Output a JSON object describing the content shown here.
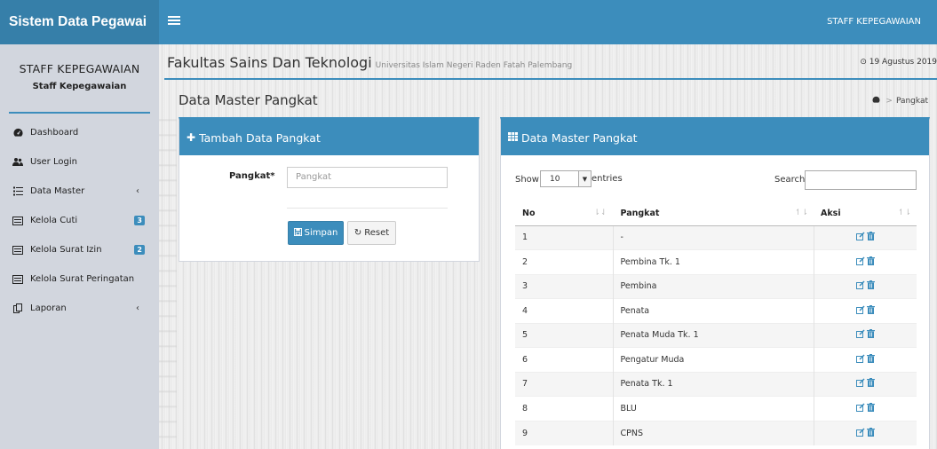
{
  "app": {
    "brand": "Sistem Data Pegawai",
    "nav_user": "STAFF KEPEGAWAIAN"
  },
  "sidebar": {
    "user_name": "STAFF KEPEGAWAIAN",
    "user_role": "Staff Kepegawaian",
    "items": [
      {
        "label": "Dashboard",
        "icon": "dashboard-icon"
      },
      {
        "label": "User Login",
        "icon": "users-icon"
      },
      {
        "label": "Data Master",
        "icon": "list-icon",
        "chevron": "‹"
      },
      {
        "label": "Kelola Cuti",
        "icon": "list-alt-icon",
        "badge": "3"
      },
      {
        "label": "Kelola Surat Izin",
        "icon": "list-alt-icon",
        "badge": "2"
      },
      {
        "label": "Kelola Surat Peringatan",
        "icon": "list-alt-icon"
      },
      {
        "label": "Laporan",
        "icon": "copy-icon",
        "chevron": "‹"
      }
    ]
  },
  "header": {
    "faculty": "Fakultas Sains Dan Teknologi",
    "university": "Universitas Islam Negeri Raden Fatah Palembang",
    "date": "⊙ 19 Agustus 2019"
  },
  "page": {
    "title": "Data Master Pangkat",
    "breadcrumb_current": "Pangkat"
  },
  "form": {
    "title": "Tambah Data Pangkat",
    "label": "Pangkat*",
    "placeholder": "Pangkat",
    "save_label": "Simpan",
    "reset_label": "Reset"
  },
  "table": {
    "title": "Data Master Pangkat",
    "show_label": "Show",
    "page_size": "10",
    "entries_label": "entries",
    "search_label": "Search:",
    "columns": [
      "No",
      "Pangkat",
      "Aksi"
    ],
    "rows": [
      {
        "no": "1",
        "pangkat": "-"
      },
      {
        "no": "2",
        "pangkat": "Pembina Tk. 1"
      },
      {
        "no": "3",
        "pangkat": "Pembina"
      },
      {
        "no": "4",
        "pangkat": "Penata"
      },
      {
        "no": "5",
        "pangkat": "Penata Muda Tk. 1"
      },
      {
        "no": "6",
        "pangkat": "Pengatur Muda"
      },
      {
        "no": "7",
        "pangkat": "Penata Tk. 1"
      },
      {
        "no": "8",
        "pangkat": "BLU"
      },
      {
        "no": "9",
        "pangkat": "CPNS"
      }
    ]
  },
  "colors": {
    "primary": "#3c8dbc",
    "brand_dark": "#367fa9",
    "sidebar_bg": "#d2d6de"
  }
}
